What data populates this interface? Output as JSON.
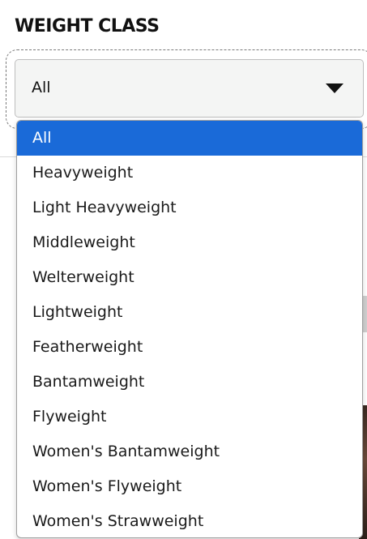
{
  "filter": {
    "label": "WEIGHT CLASS",
    "selected_value": "All",
    "dropdown_icon": "caret-down-icon"
  },
  "options": [
    {
      "label": "All",
      "selected": true
    },
    {
      "label": "Heavyweight",
      "selected": false
    },
    {
      "label": "Light Heavyweight",
      "selected": false
    },
    {
      "label": "Middleweight",
      "selected": false
    },
    {
      "label": "Welterweight",
      "selected": false
    },
    {
      "label": "Lightweight",
      "selected": false
    },
    {
      "label": "Featherweight",
      "selected": false
    },
    {
      "label": "Bantamweight",
      "selected": false
    },
    {
      "label": "Flyweight",
      "selected": false
    },
    {
      "label": "Women's Bantamweight",
      "selected": false
    },
    {
      "label": "Women's Flyweight",
      "selected": false
    },
    {
      "label": "Women's Strawweight",
      "selected": false
    }
  ],
  "colors": {
    "highlight": "#1a6ad8",
    "select_background": "#f4f5f4",
    "text": "#111111"
  }
}
